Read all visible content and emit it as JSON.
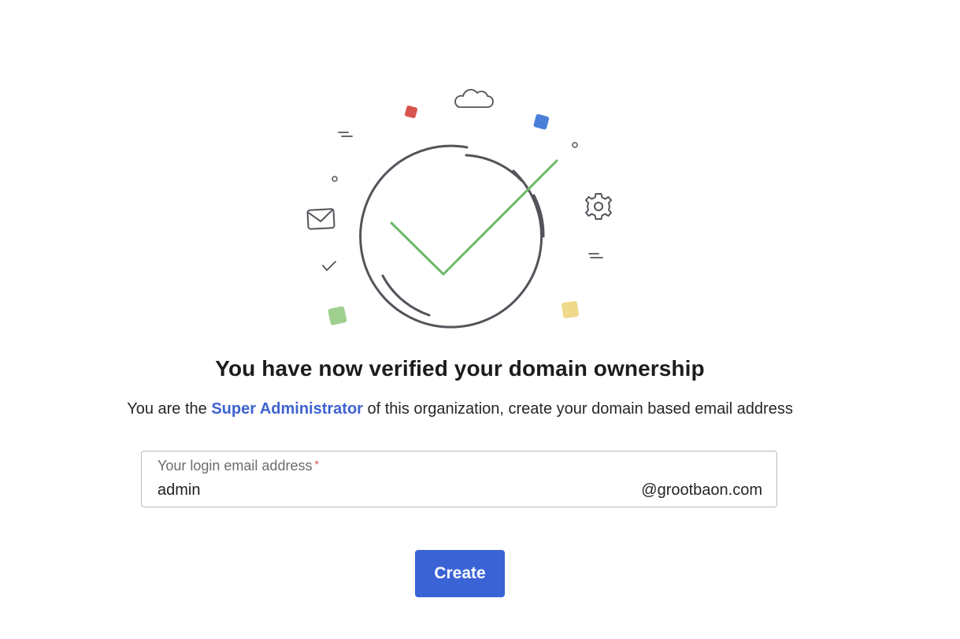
{
  "heading": "You have now verified your domain ownership",
  "subtext": {
    "before": "You are the ",
    "role": "Super Administrator",
    "after": " of this organization, create your domain based email address"
  },
  "email_field": {
    "label": "Your login email address",
    "required_marker": "*",
    "value": "admin",
    "domain": "@grootbaon.com"
  },
  "actions": {
    "create_label": "Create"
  },
  "illustration": {
    "check_color": "#6db86a",
    "circle_color": "#55535a",
    "accent_colors": {
      "red_square": "#d9534f",
      "blue_square": "#4a7fd9",
      "green_square": "#9fd08f",
      "yellow_square": "#efd98a"
    },
    "icons": [
      "cloud-icon",
      "envelope-icon",
      "gear-icon",
      "small-check-icon",
      "big-check-icon"
    ]
  },
  "colors": {
    "primary": "#3a63d6",
    "link": "#3e63d0",
    "required": "#d9534f"
  }
}
